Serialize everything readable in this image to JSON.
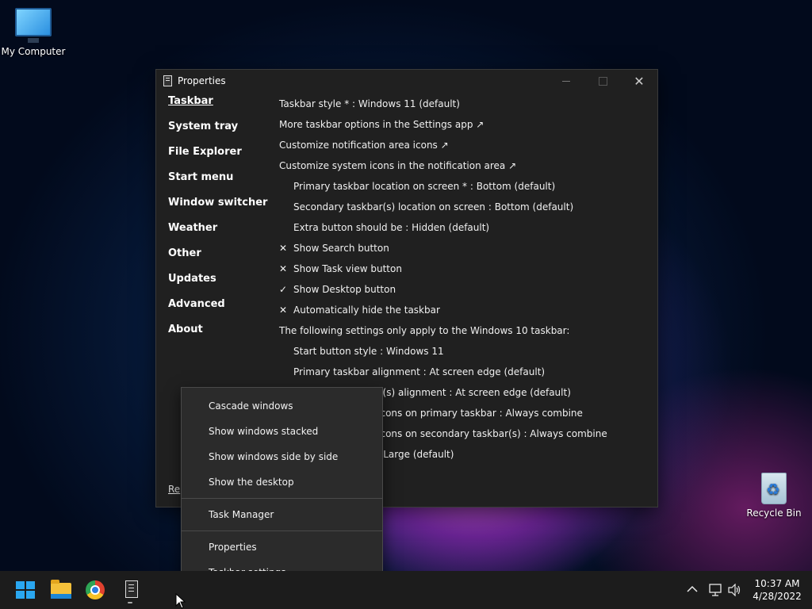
{
  "desktop": {
    "icons": [
      {
        "label": "My Computer"
      },
      {
        "label": "Recycle Bin"
      }
    ]
  },
  "window": {
    "title": "Properties",
    "nav": [
      "Taskbar",
      "System tray",
      "File Explorer",
      "Start menu",
      "Window switcher",
      "Weather",
      "Other",
      "Updates",
      "Advanced",
      "About"
    ],
    "active_nav": "Taskbar",
    "reset_link": "Re",
    "rows": [
      {
        "text": "Taskbar style * : Windows 11 (default)",
        "mark": "",
        "indent": false
      },
      {
        "text": "More taskbar options in the Settings app ↗",
        "mark": "",
        "indent": false
      },
      {
        "text": "Customize notification area icons ↗",
        "mark": "",
        "indent": false
      },
      {
        "text": "Customize system icons in the notification area ↗",
        "mark": "",
        "indent": false
      },
      {
        "text": "Primary taskbar location on screen * : Bottom (default)",
        "mark": "",
        "indent": true
      },
      {
        "text": "Secondary taskbar(s) location on screen : Bottom (default)",
        "mark": "",
        "indent": true
      },
      {
        "text": "Extra button should be : Hidden (default)",
        "mark": "",
        "indent": true
      },
      {
        "text": "Show Search button",
        "mark": "✕",
        "indent": false
      },
      {
        "text": "Show Task view button",
        "mark": "✕",
        "indent": false
      },
      {
        "text": "Show Desktop button",
        "mark": "✓",
        "indent": false
      },
      {
        "text": "Automatically hide the taskbar",
        "mark": "✕",
        "indent": false
      },
      {
        "text": "The following settings only apply to the Windows 10 taskbar:",
        "mark": "",
        "indent": false
      },
      {
        "text": "Start button style : Windows 11",
        "mark": "",
        "indent": true
      },
      {
        "text": "Primary taskbar alignment : At screen edge (default)",
        "mark": "",
        "indent": true
      },
      {
        "text": "Secondary taskbar(s) alignment : At screen edge (default)",
        "mark": "",
        "indent": true
      },
      {
        "text": "Combine taskbar icons on primary taskbar : Always combine",
        "mark": "",
        "indent": true
      },
      {
        "text": "Combine taskbar icons on secondary taskbar(s) : Always combine",
        "mark": "",
        "indent": true
      },
      {
        "text": "Taskbar icon size : Large (default)",
        "mark": "",
        "indent": true
      }
    ]
  },
  "context_menu": {
    "group1": [
      "Cascade windows",
      "Show windows stacked",
      "Show windows side by side",
      "Show the desktop"
    ],
    "group2": [
      "Task Manager"
    ],
    "group3": [
      "Properties",
      "Taskbar settings"
    ]
  },
  "taskbar": {
    "apps": [
      "windows-start",
      "file-explorer",
      "chrome",
      "properties-app"
    ],
    "clock_time": "10:37 AM",
    "clock_date": "4/28/2022"
  },
  "colors": {
    "accent": "#2aa7f0",
    "window_bg": "#202020",
    "menu_bg": "#2b2b2b",
    "taskbar_bg": "#1c1c1c"
  }
}
